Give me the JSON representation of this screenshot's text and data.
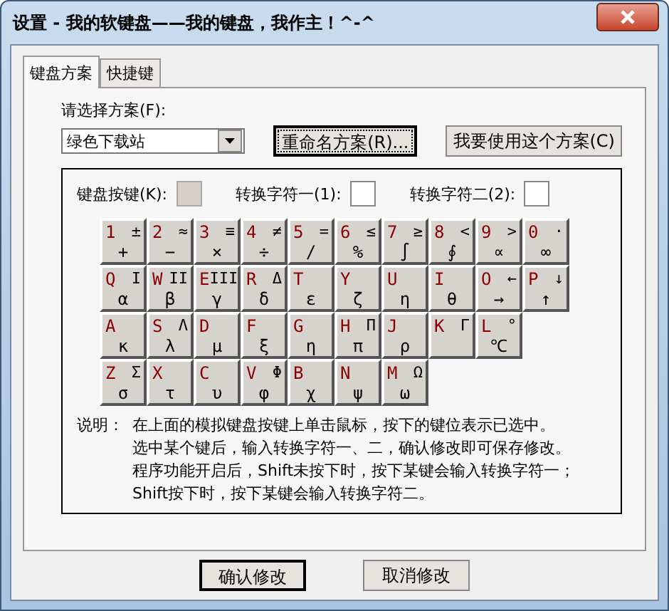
{
  "window": {
    "title": "设置 - 我的软键盘——我的键盘，我作主！^-^"
  },
  "tabs": [
    {
      "label": "键盘方案",
      "selected": true
    },
    {
      "label": "快捷键",
      "selected": false
    }
  ],
  "scheme": {
    "label": "请选择方案(F):",
    "value": "绿色下载站",
    "buttons": [
      {
        "label": "重命名方案(R)...",
        "focused": true
      },
      {
        "label": "我要使用这个方案(C)",
        "focused": false
      }
    ]
  },
  "fields": [
    {
      "label": "键盘按键(K):",
      "disabled": true
    },
    {
      "label": "转换字符一(1):",
      "disabled": false
    },
    {
      "label": "转换字符二(2):",
      "disabled": false
    }
  ],
  "keyboard": [
    [
      {
        "key": "1",
        "upper": "±",
        "lower": "+"
      },
      {
        "key": "2",
        "upper": "≈",
        "lower": "−"
      },
      {
        "key": "3",
        "upper": "≡",
        "lower": "×"
      },
      {
        "key": "4",
        "upper": "≠",
        "lower": "÷"
      },
      {
        "key": "5",
        "upper": "=",
        "lower": "∕"
      },
      {
        "key": "6",
        "upper": "≤",
        "lower": "%"
      },
      {
        "key": "7",
        "upper": "≥",
        "lower": "∫"
      },
      {
        "key": "8",
        "upper": "<",
        "lower": "∮"
      },
      {
        "key": "9",
        "upper": ">",
        "lower": "∝"
      },
      {
        "key": "0",
        "upper": "·",
        "lower": "∞"
      }
    ],
    [
      {
        "key": "Q",
        "upper": "Ι",
        "lower": "α"
      },
      {
        "key": "W",
        "upper": "ΙΙ",
        "lower": "β"
      },
      {
        "key": "E",
        "upper": "ΙΙΙ",
        "lower": "γ"
      },
      {
        "key": "R",
        "upper": "Δ",
        "lower": "δ"
      },
      {
        "key": "T",
        "lower": "ε"
      },
      {
        "key": "Y",
        "lower": "ζ"
      },
      {
        "key": "U",
        "lower": "η"
      },
      {
        "key": "I",
        "lower": "θ"
      },
      {
        "key": "O",
        "upper": "←",
        "lower": "→"
      },
      {
        "key": "P",
        "upper": "↓",
        "lower": "↑"
      }
    ],
    [
      {
        "key": "A",
        "lower": "κ"
      },
      {
        "key": "S",
        "upper": "Λ",
        "lower": "λ"
      },
      {
        "key": "D",
        "lower": "μ"
      },
      {
        "key": "F",
        "lower": "ξ"
      },
      {
        "key": "G",
        "lower": "η"
      },
      {
        "key": "H",
        "upper": "Π",
        "lower": "π"
      },
      {
        "key": "J",
        "lower": "ρ"
      },
      {
        "key": "K",
        "upper": "Γ"
      },
      {
        "key": "L",
        "upper": "°",
        "lower": "℃"
      }
    ],
    [
      {
        "key": "Z",
        "upper": "Σ",
        "lower": "σ"
      },
      {
        "key": "X",
        "lower": "τ"
      },
      {
        "key": "C",
        "lower": "υ"
      },
      {
        "key": "V",
        "upper": "Φ",
        "lower": "φ"
      },
      {
        "key": "B",
        "lower": "χ"
      },
      {
        "key": "N",
        "lower": "ψ"
      },
      {
        "key": "M",
        "upper": "Ω",
        "lower": "ω"
      }
    ]
  ],
  "note": {
    "label": "说明：",
    "lines": [
      "在上面的模拟键盘按键上单击鼠标，按下的键位表示已选中。",
      "选中某个键后，输入转换字符一、二，确认修改即可保存修改。",
      "程序功能开启后，Shift未按下时，按下某键会输入转换字符一；",
      "Shift按下时，按下某键会输入转换字符二。"
    ]
  },
  "footer_buttons": [
    {
      "label": "确认修改",
      "default": true
    },
    {
      "label": "取消修改",
      "default": false
    }
  ]
}
